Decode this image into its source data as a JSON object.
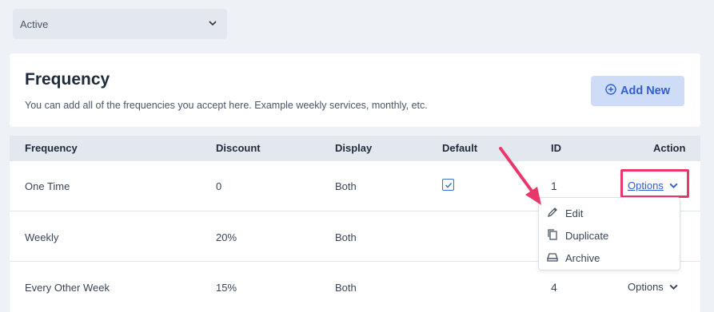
{
  "filter": {
    "value": "Active"
  },
  "header": {
    "title": "Frequency",
    "subtitle": "You can add all of the frequencies you accept here. Example weekly services, monthly, etc.",
    "add_new_label": "Add New"
  },
  "table": {
    "columns": [
      "Frequency",
      "Discount",
      "Display",
      "Default",
      "ID",
      "Action"
    ],
    "rows": [
      {
        "frequency": "One Time",
        "discount": "0",
        "display": "Both",
        "default": true,
        "id": "1",
        "action": "Options"
      },
      {
        "frequency": "Weekly",
        "discount": "20%",
        "display": "Both",
        "default": false,
        "id": "",
        "action": ""
      },
      {
        "frequency": "Every Other Week",
        "discount": "15%",
        "display": "Both",
        "default": false,
        "id": "4",
        "action": "Options"
      }
    ]
  },
  "dropdown": {
    "items": [
      "Edit",
      "Duplicate",
      "Archive"
    ]
  },
  "colors": {
    "accent": "#2f5fd0",
    "highlight": "#e8386a",
    "background": "#eef2f7"
  },
  "icons": [
    "chevron-down-icon",
    "plus-circle-icon",
    "checkmark-icon",
    "pencil-icon",
    "copy-icon",
    "archive-icon",
    "annotation-arrow"
  ]
}
